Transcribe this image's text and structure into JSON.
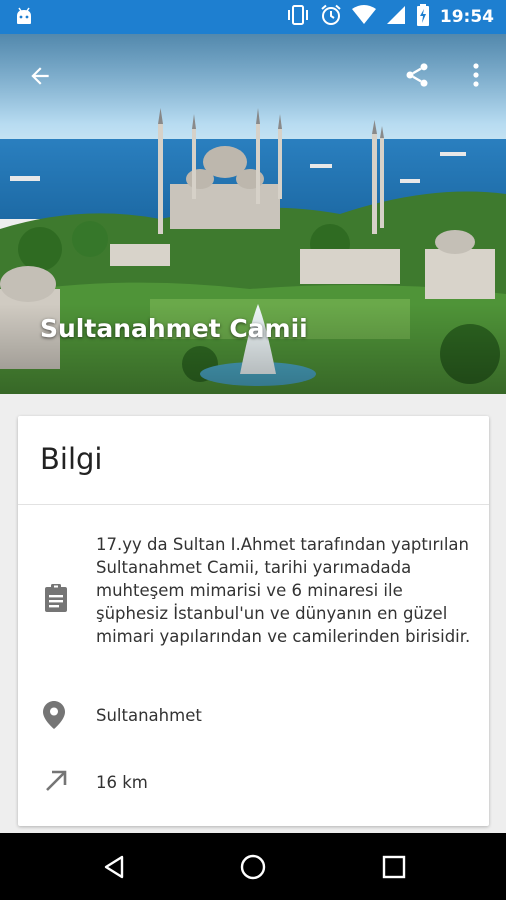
{
  "status_bar": {
    "time": "19:54",
    "icons": [
      "android-icon",
      "vibrate-icon",
      "alarm-icon",
      "wifi-icon",
      "signal-icon",
      "battery-charging-icon"
    ],
    "color": "#1e7fd0"
  },
  "toolbar": {
    "back_icon": "arrow-back-icon",
    "share_icon": "share-icon",
    "more_icon": "more-vert-icon"
  },
  "hero": {
    "title": "Sultanahmet Camii"
  },
  "info_card": {
    "title": "Bilgi",
    "rows": [
      {
        "icon": "clipboard-icon",
        "text": "17.yy da Sultan I.Ahmet tarafından yaptırılan Sultanahmet Camii, tarihi yarımadada muhteşem mimarisi ve 6 minaresi ile şüphesiz İstanbul'un ve dünyanın en güzel mimari yapılarından ve camilerinden birisidir."
      },
      {
        "icon": "location-pin-icon",
        "text": "Sultanahmet"
      },
      {
        "icon": "arrow-up-right-icon",
        "text": "16 km"
      }
    ]
  },
  "nav_bar": {
    "back_icon": "nav-back-icon",
    "home_icon": "nav-home-icon",
    "recents_icon": "nav-recents-icon"
  }
}
